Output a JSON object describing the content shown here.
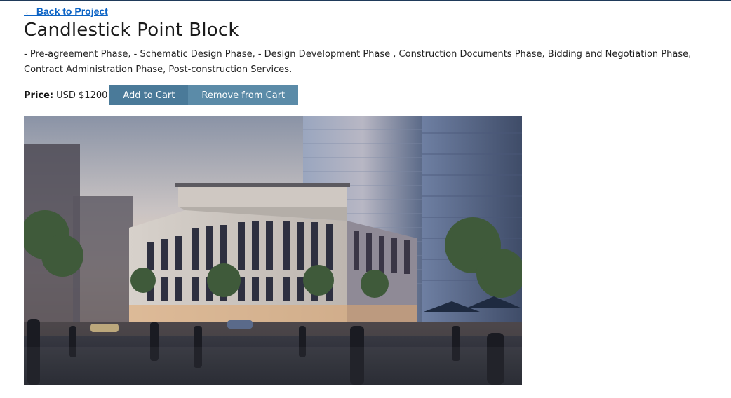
{
  "nav": {
    "back_label": "← Back to Project"
  },
  "product": {
    "title": "Candlestick Point Block",
    "description": "- Pre-agreement Phase, - Schematic Design Phase, - Design Development Phase , Construction Documents Phase, Bidding and Negotiation Phase, Contract Administration Phase, Post-construction Services.",
    "price_label": "Price:",
    "price_value": "USD $1200"
  },
  "actions": {
    "add_label": "Add to Cart",
    "remove_label": "Remove from Cart"
  },
  "colors": {
    "link": "#0b63c5",
    "button_add": "#4a7a99",
    "button_remove": "#5b8ba8",
    "top_border": "#1f3a5a"
  }
}
